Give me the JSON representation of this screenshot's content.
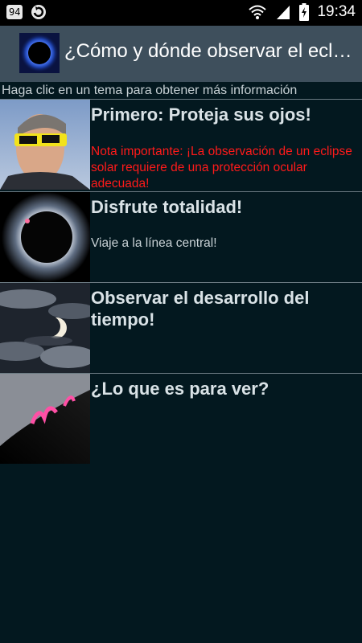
{
  "status_bar": {
    "notification_badge": "94",
    "time": "19:34"
  },
  "app_bar": {
    "title": "¿Cómo y dónde observar el eclipse solar?"
  },
  "hint": "Haga clic en un tema para obtener más información",
  "topics": [
    {
      "title": "Primero: Proteja sus ojos!",
      "description": "Nota importante: ¡La observación de un eclipse solar requiere de una protección ocular adecuada!"
    },
    {
      "title": "Disfrute totalidad!",
      "description": "Viaje a la línea central!"
    },
    {
      "title": "Observar el desarrollo del tiempo!",
      "description": ""
    },
    {
      "title": "¿Lo que es para ver?",
      "description": ""
    }
  ],
  "colors": {
    "background": "#03181f",
    "app_bar": "#3e4f5c",
    "warning_text": "#ff1a1a"
  }
}
